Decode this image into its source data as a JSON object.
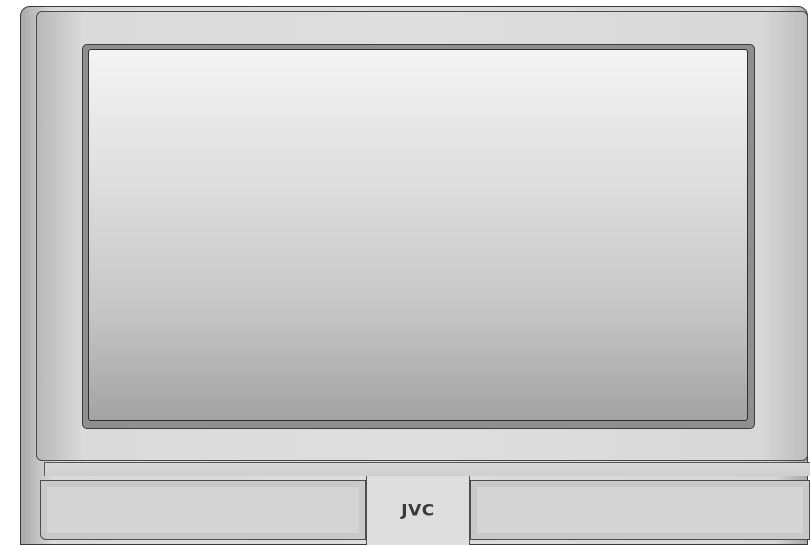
{
  "device": {
    "brand_logo": "JVC",
    "colors": {
      "frame_outline": "#3a3a3a",
      "body": "#dcdcdc",
      "screen_top": "#f4f4f4",
      "screen_bottom": "#a3a3a3"
    }
  }
}
